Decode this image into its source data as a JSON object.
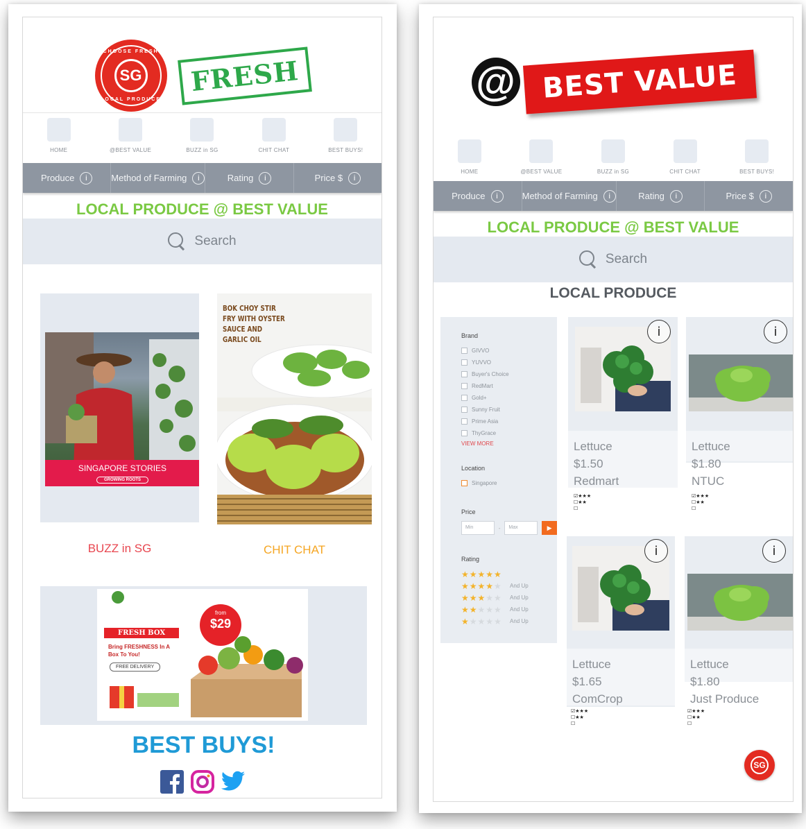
{
  "left": {
    "logo": {
      "seal_top": "CHOOSE FRESH",
      "seal_core": "SG",
      "seal_bottom": "LOCAL PRODUCE",
      "stamp": "FRESH"
    },
    "nav": [
      {
        "label": "HOME"
      },
      {
        "label": "@BEST VALUE"
      },
      {
        "label": "BUZZ in SG"
      },
      {
        "label": "CHIT CHAT"
      },
      {
        "label": "BEST BUYS!"
      }
    ],
    "filters": [
      {
        "label": "Produce"
      },
      {
        "label": "Method of Farming"
      },
      {
        "label": "Rating"
      },
      {
        "label": "Price $"
      }
    ],
    "title": "LOCAL PRODUCE @ BEST VALUE",
    "search_placeholder": "Search",
    "tiles": {
      "buzz": {
        "label": "BUZZ in SG",
        "banner": "SINGAPORE STORIES",
        "sub_banner": "GROWING ROOTS",
        "color": "#e8464f"
      },
      "chit": {
        "label": "CHIT CHAT",
        "recipe": "BOK CHOY STIR FRY WITH OYSTER SAUCE AND GARLIC OIL",
        "color": "#f5a623"
      },
      "best": {
        "label": "BEST BUYS!",
        "from": "from",
        "price": "$29",
        "box_title": "FRESH BOX",
        "tagline": "Bring FRESHNESS In A Box To You!",
        "delivery": "FREE DELIVERY",
        "color": "#1f9ad6"
      }
    },
    "icon_color": "#888888",
    "social": [
      "facebook-icon",
      "instagram-icon",
      "twitter-icon"
    ]
  },
  "right": {
    "logo": {
      "at": "@",
      "banner": "BEST VALUE"
    },
    "nav": [
      {
        "label": "HOME"
      },
      {
        "label": "@BEST VALUE"
      },
      {
        "label": "BUZZ in SG"
      },
      {
        "label": "CHIT CHAT"
      },
      {
        "label": "BEST BUYS!"
      }
    ],
    "filters": [
      {
        "label": "Produce"
      },
      {
        "label": "Method of Farming"
      },
      {
        "label": "Rating"
      },
      {
        "label": "Price $"
      }
    ],
    "title": "LOCAL PRODUCE @ BEST VALUE",
    "search_placeholder": "Search",
    "section_title": "LOCAL PRODUCE",
    "sidebar": {
      "brand_head": "Brand",
      "brands": [
        "GIVVO",
        "YUVVO",
        "Buyer's Choice",
        "RedMart",
        "Gold+",
        "Sunny Fruit",
        "Prime Asia",
        "ThyGrace"
      ],
      "view_more": "VIEW MORE",
      "location_head": "Location",
      "locations": [
        "Singapore"
      ],
      "price_head": "Price",
      "price_min": "Min",
      "price_max": "Max",
      "rating_head": "Rating",
      "rating_suffix": "And Up",
      "rating_levels": [
        5,
        4,
        3,
        2,
        1
      ]
    },
    "products": [
      {
        "name": "Lettuce",
        "price": "$1.50",
        "store": "Redmart"
      },
      {
        "name": "Lettuce",
        "price": "$1.80",
        "store": "NTUC"
      },
      {
        "name": "Lettuce",
        "price": "$1.65",
        "store": "ComCrop"
      },
      {
        "name": "Lettuce",
        "price": "$1.80",
        "store": "Just Produce"
      }
    ],
    "fab": "SG"
  }
}
